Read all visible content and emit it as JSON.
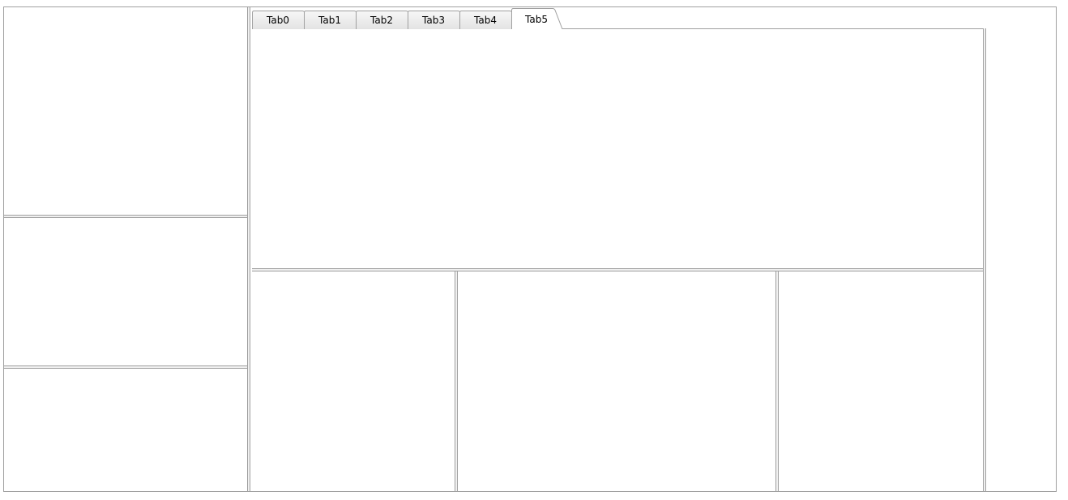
{
  "tabs": [
    {
      "label": "Tab0",
      "active": false
    },
    {
      "label": "Tab1",
      "active": false
    },
    {
      "label": "Tab2",
      "active": false
    },
    {
      "label": "Tab3",
      "active": false
    },
    {
      "label": "Tab4",
      "active": false
    },
    {
      "label": "Tab5",
      "active": true
    }
  ],
  "colors": {
    "border": "#a0a0a0",
    "tab_inactive_top": "#f7f7f7",
    "tab_inactive_bottom": "#e3e3e3",
    "tab_active": "#ffffff",
    "background": "#ffffff"
  }
}
